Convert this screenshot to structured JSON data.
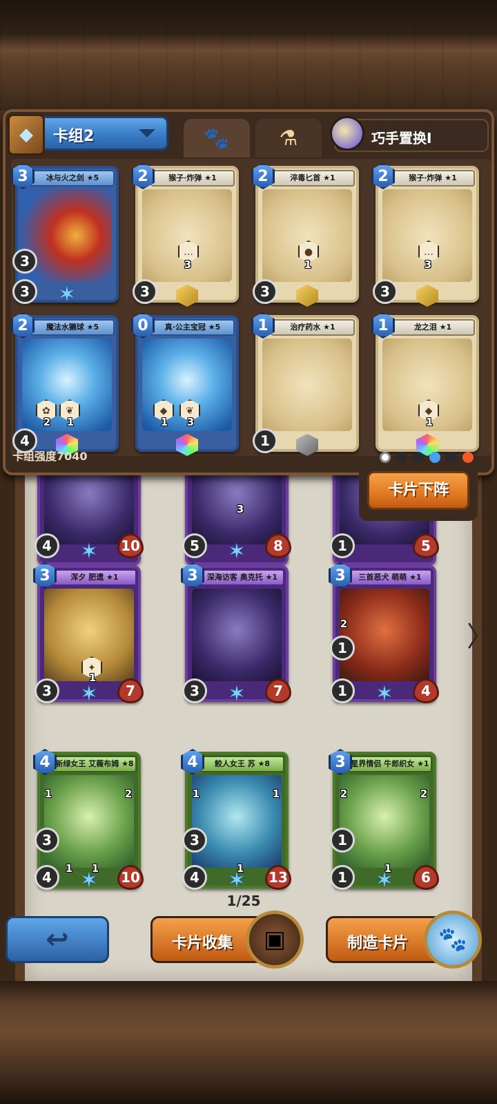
{
  "header": {
    "deck_label": "卡组2",
    "ability_label": "巧手置换Ⅰ"
  },
  "deck_cards": [
    {
      "name": "冰与火之剑 ★5",
      "cost": "3",
      "atk": "3",
      "left_badge": "3"
    },
    {
      "name": "猴子·炸弹 ★1",
      "cost": "2",
      "atk": "3",
      "badge": "3"
    },
    {
      "name": "淬毒匕首 ★1",
      "cost": "2",
      "atk": "3",
      "badge": "1"
    },
    {
      "name": "猴子·炸弹 ★1",
      "cost": "2",
      "atk": "3",
      "badge": "3"
    },
    {
      "name": "魔法水獭球 ★5",
      "cost": "2",
      "atk": "4",
      "badge_a": "2",
      "badge_b": "1"
    },
    {
      "name": "真·公主宝冠 ★5",
      "cost": "0",
      "badge_a": "1",
      "badge_b": "3"
    },
    {
      "name": "治疗药水 ★1",
      "cost": "1",
      "atk": "1"
    },
    {
      "name": "龙之泪 ★1",
      "cost": "1",
      "badge": "1"
    }
  ],
  "deck_strength": "卡组强度7040",
  "remove_button": "卡片下阵",
  "partial_row": [
    {
      "top": "4",
      "atk": "4",
      "hp": "10"
    },
    {
      "atk": "5",
      "badge": "3",
      "hp": "8"
    },
    {
      "atk": "1",
      "hp": "5"
    }
  ],
  "collection": [
    {
      "name": "浑夕 肥遗 ★1",
      "cost": "3",
      "atk": "3",
      "hp": "7",
      "badge": "1"
    },
    {
      "name": "深海访客 奥克托 ★1",
      "cost": "3",
      "atk": "3",
      "hp": "7"
    },
    {
      "name": "三首恶犬 萌萌 ★1",
      "cost": "3",
      "atk": "1",
      "hp": "4",
      "badge_top": "2",
      "badge_mid": "1"
    },
    {
      "name": "新绿女王 艾薇布姆 ★8",
      "cost": "4",
      "atk": "4",
      "hp": "10",
      "l1": "1",
      "r1": "2",
      "side": "3",
      "b1": "1",
      "b2": "1"
    },
    {
      "name": "鲛人女王 苏 ★8",
      "cost": "4",
      "atk": "4",
      "hp": "13",
      "l1": "1",
      "r1": "1",
      "side": "3",
      "b1": "1"
    },
    {
      "name": "星界情侣 牛郎织女 ★1",
      "cost": "3",
      "atk": "1",
      "hp": "6",
      "l1": "2",
      "r1": "2",
      "side": "1",
      "b1": "1"
    }
  ],
  "page_indicator": "1/25",
  "bottom_buttons": {
    "collect": "卡片收集",
    "craft": "制造卡片"
  },
  "icons": {
    "back": "↩",
    "next": "〉",
    "paw": "🐾",
    "potion": "⚗",
    "star": "✶"
  }
}
